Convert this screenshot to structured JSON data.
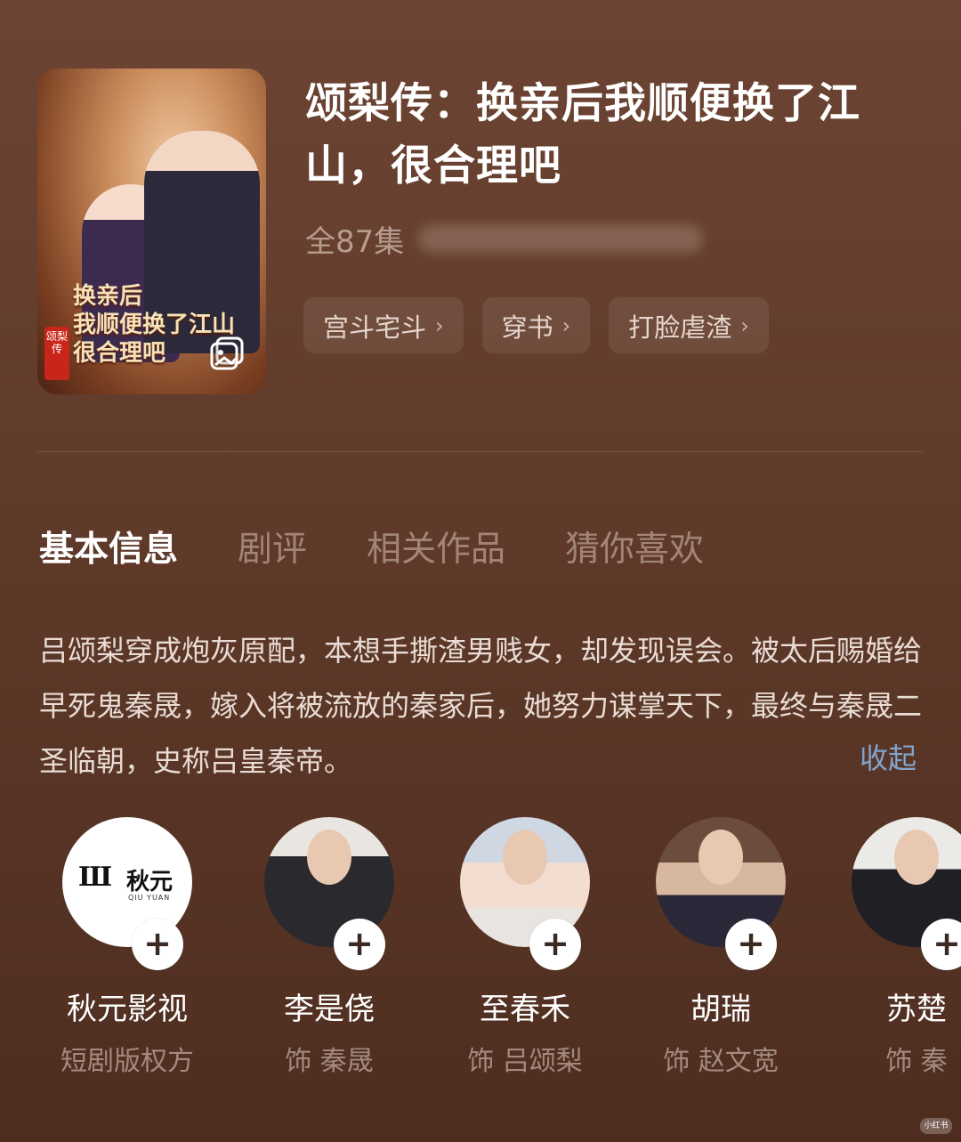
{
  "poster": {
    "title_line1": "换亲后",
    "title_line2": "我顺便换了江山",
    "title_line3": "很合理吧",
    "seal_text": "颂梨传"
  },
  "drama": {
    "title": "颂梨传：换亲后我顺便换了江山，很合理吧",
    "episodes": "全87集"
  },
  "tags": [
    {
      "label": "宫斗宅斗"
    },
    {
      "label": "穿书"
    },
    {
      "label": "打脸虐渣"
    }
  ],
  "tabs": [
    {
      "label": "基本信息"
    },
    {
      "label": "剧评"
    },
    {
      "label": "相关作品"
    },
    {
      "label": "猜你喜欢"
    }
  ],
  "synopsis": {
    "text": "吕颂梨穿成炮灰原配，本想手撕渣男贱女，却发现误会。被太后赐婚给早死鬼秦晟，嫁入将被流放的秦家后，她努力谋掌天下，最终与秦晟二圣临朝，史称吕皇秦帝。",
    "collapse_label": "收起"
  },
  "cast": [
    {
      "name": "秋元影视",
      "role": "短剧版权方",
      "logo_text": "秋元",
      "logo_sub": "QIU YUAN"
    },
    {
      "name": "李是侥",
      "role": "饰 秦晟"
    },
    {
      "name": "至春禾",
      "role": "饰 吕颂梨"
    },
    {
      "name": "胡瑞",
      "role": "饰 赵文宽"
    },
    {
      "name": "苏楚",
      "role": "饰 秦"
    }
  ],
  "icons": {
    "chevron": "chevron-right-icon",
    "plus": "plus-icon",
    "gallery": "gallery-icon"
  },
  "watermark": "小红书"
}
